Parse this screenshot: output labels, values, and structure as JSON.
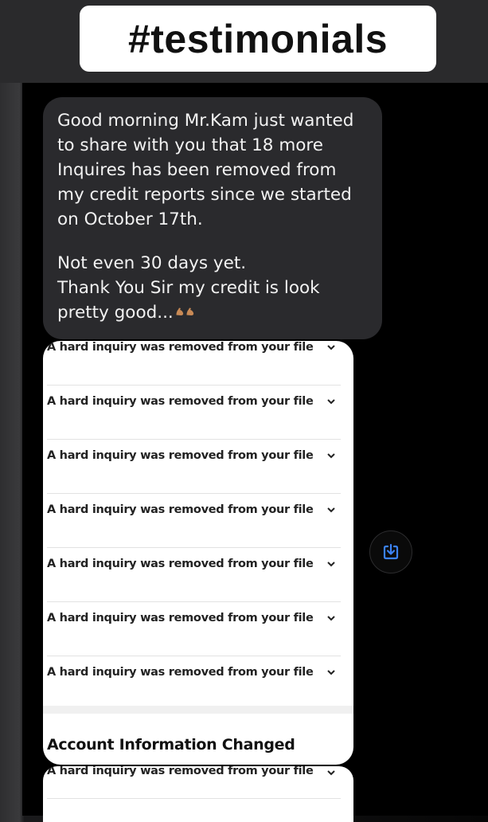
{
  "header": {
    "title": "#testimonials"
  },
  "message": {
    "paragraph1": "Good morning Mr.Kam just wanted to share with you that 18 more Inquires has been removed from my credit reports since we started on October 17th.",
    "line2": "Not even 30 days yet.",
    "line3": "Thank You Sir my credit is look pretty good...",
    "emoji": "flexed-biceps-icon x2"
  },
  "screenshot_card": {
    "rows": [
      {
        "text": "A hard inquiry was removed from your file"
      },
      {
        "text": "A hard inquiry was removed from your file"
      },
      {
        "text": "A hard inquiry was removed from your file"
      },
      {
        "text": "A hard inquiry was removed from your file"
      },
      {
        "text": "A hard inquiry was removed from your file"
      },
      {
        "text": "A hard inquiry was removed from your file"
      },
      {
        "text": "A hard inquiry was removed from your file"
      }
    ],
    "section_title": "Account Information Changed"
  },
  "second_card": {
    "row_text": "A hard inquiry was removed from your file"
  },
  "save_button": {
    "icon": "save-to-device-icon",
    "color": "#3b82f6"
  },
  "colors": {
    "bubble": "#2a2a2d",
    "background": "#000000",
    "accent": "#3b82f6"
  }
}
